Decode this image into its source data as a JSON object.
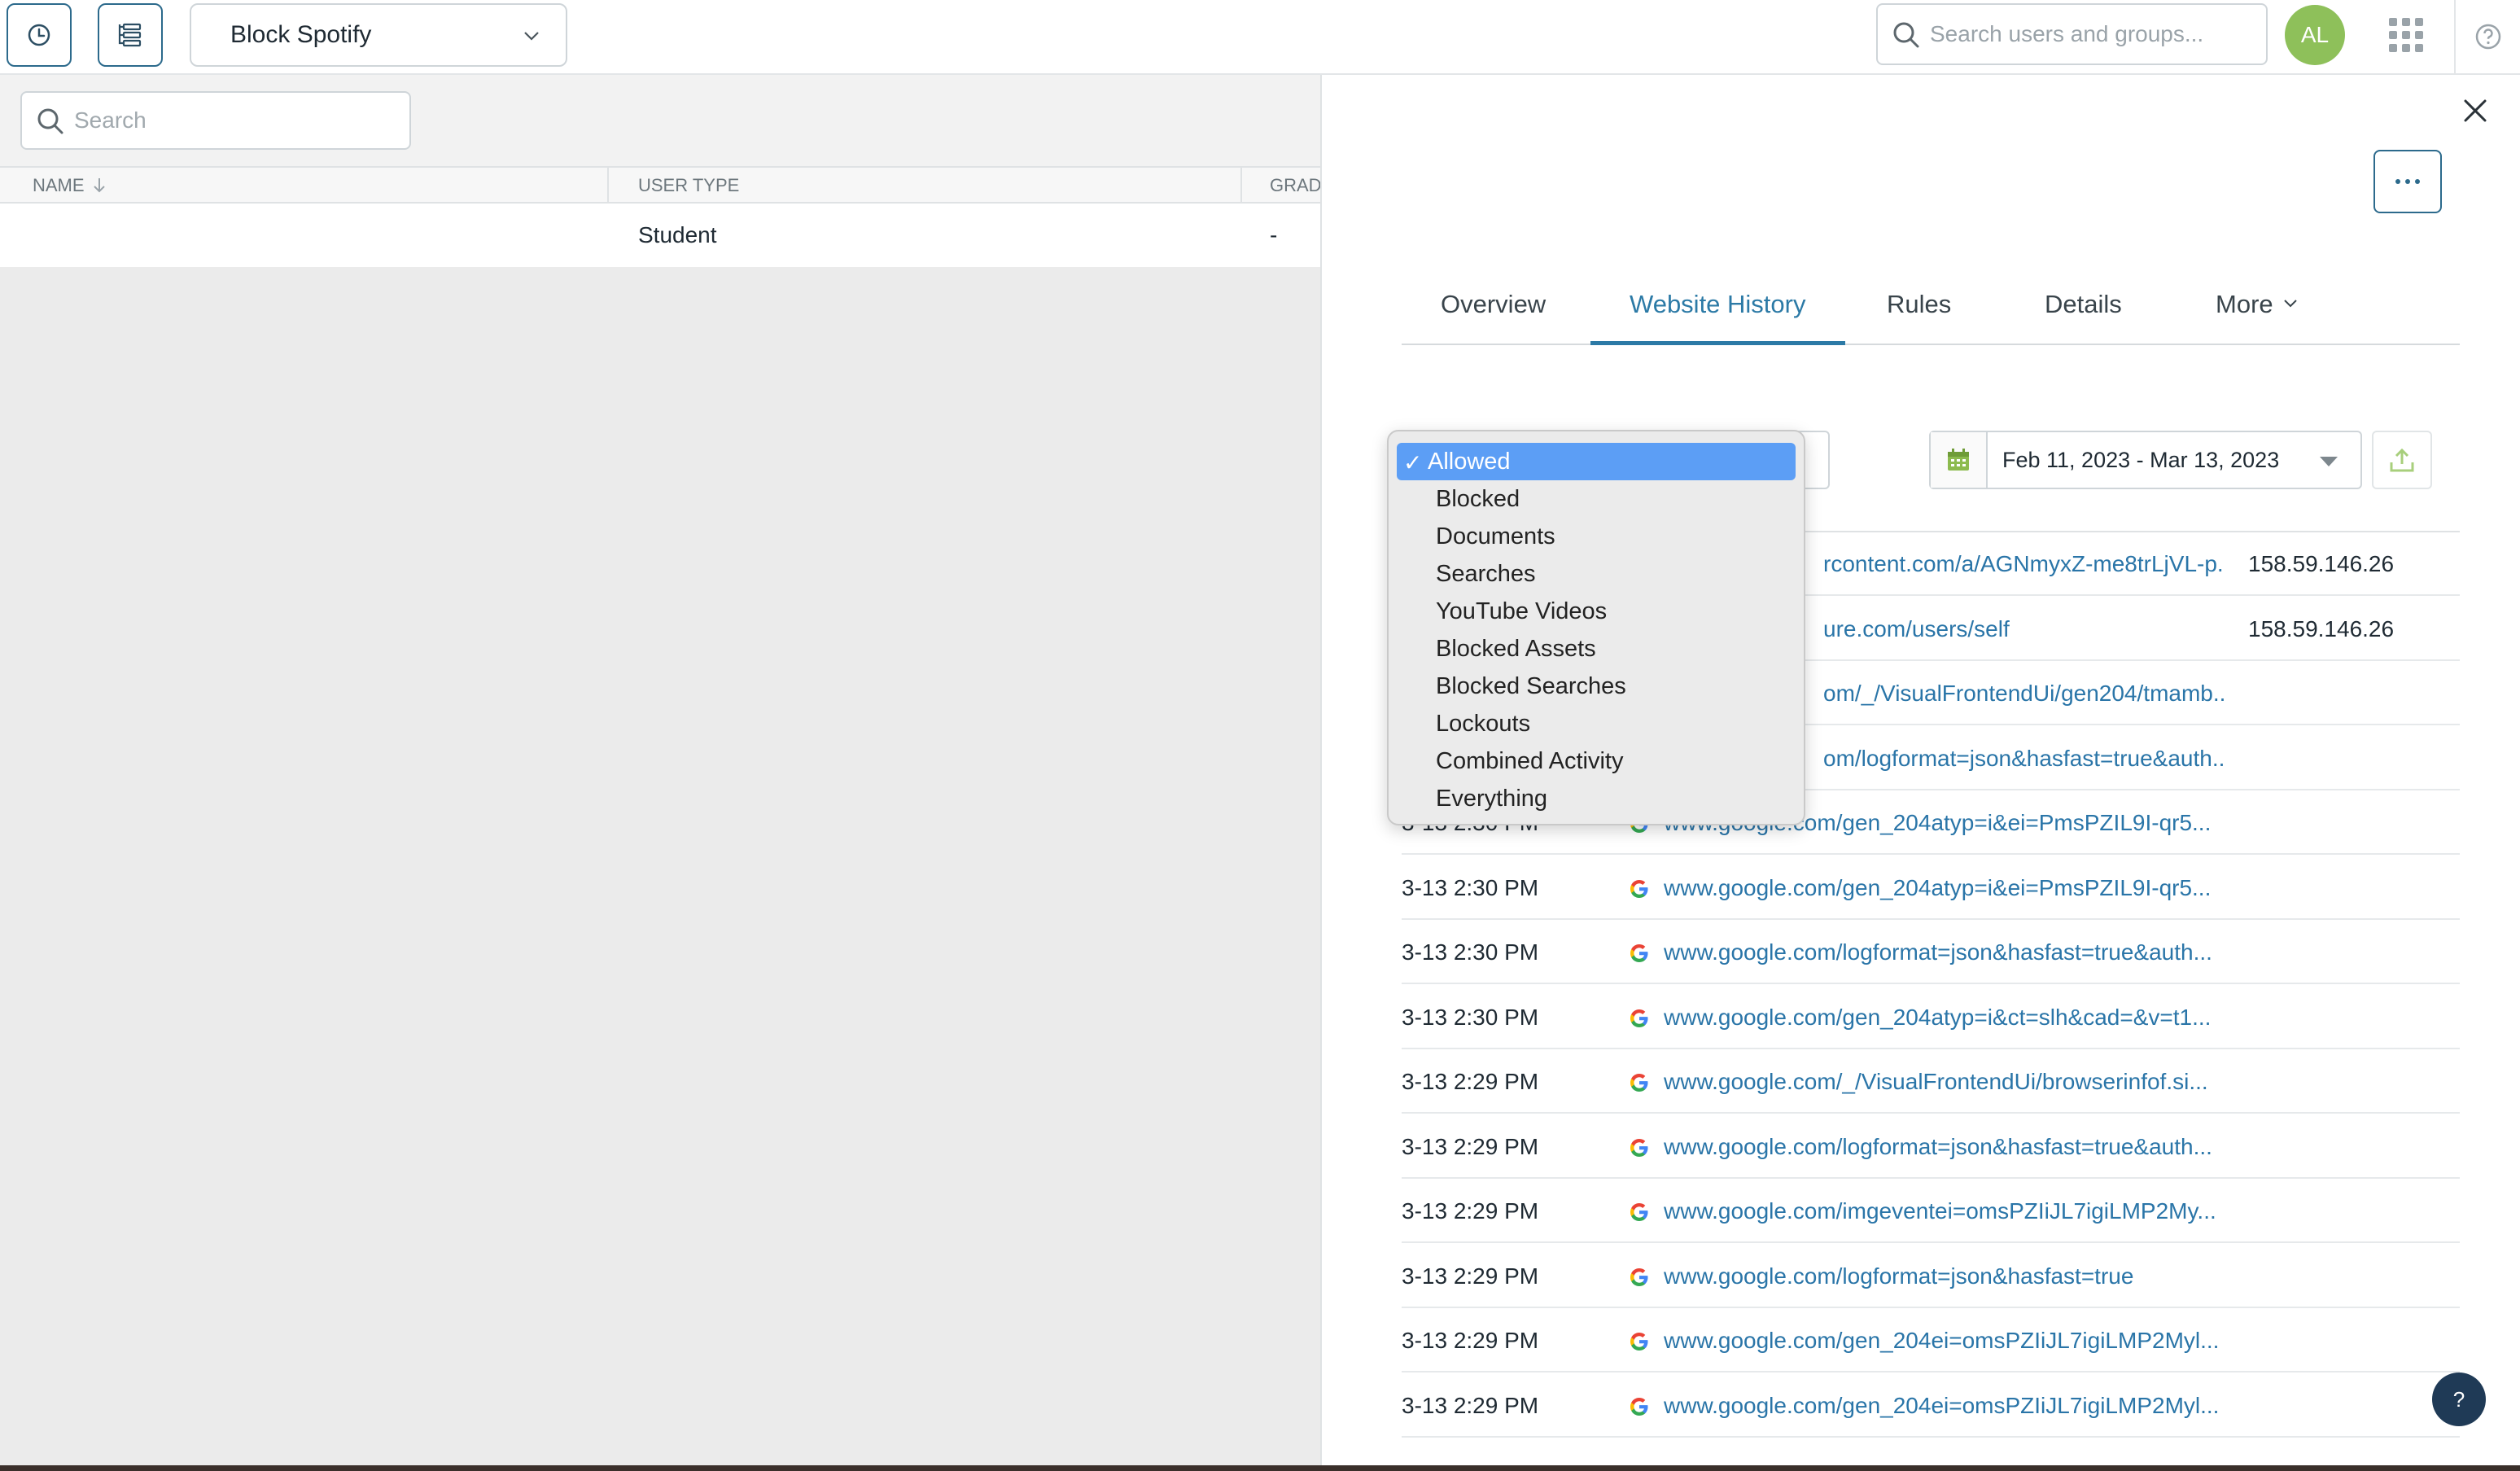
{
  "topbar": {
    "policy_select": "Block Spotify",
    "search_placeholder": "Search users and groups...",
    "avatar_initials": "AL"
  },
  "left": {
    "search_placeholder": "Search",
    "columns": [
      "NAME",
      "USER TYPE",
      "GRAD"
    ],
    "row": {
      "name": "",
      "user_type": "Student",
      "grade": "-"
    }
  },
  "right": {
    "tabs": [
      "Overview",
      "Website History",
      "Rules",
      "Details",
      "More"
    ],
    "active_tab": "Website History",
    "date_range": "Feb 11, 2023 - Mar 13, 2023",
    "history": [
      {
        "time": "",
        "url": "rcontent.com/a/AGNmyxZ-me8trLjVL-p...",
        "ip": "158.59.146.26"
      },
      {
        "time": "",
        "url": "ure.com/users/self",
        "ip": "158.59.146.26"
      },
      {
        "time": "",
        "url": "om/_/VisualFrontendUi/gen204/tmamb...",
        "ip": ""
      },
      {
        "time": "",
        "url": "om/logformat=json&hasfast=true&auth...",
        "ip": ""
      },
      {
        "time": "3-13 2:30 PM",
        "url": "www.google.com/gen_204atyp=i&ei=PmsPZIL9I-qr5...",
        "ip": ""
      },
      {
        "time": "3-13 2:30 PM",
        "url": "www.google.com/gen_204atyp=i&ei=PmsPZIL9I-qr5...",
        "ip": ""
      },
      {
        "time": "3-13 2:30 PM",
        "url": "www.google.com/logformat=json&hasfast=true&auth...",
        "ip": ""
      },
      {
        "time": "3-13 2:30 PM",
        "url": "www.google.com/gen_204atyp=i&ct=slh&cad=&v=t1...",
        "ip": ""
      },
      {
        "time": "3-13 2:29 PM",
        "url": "www.google.com/_/VisualFrontendUi/browserinfof.si...",
        "ip": ""
      },
      {
        "time": "3-13 2:29 PM",
        "url": "www.google.com/logformat=json&hasfast=true&auth...",
        "ip": ""
      },
      {
        "time": "3-13 2:29 PM",
        "url": "www.google.com/imgeventei=omsPZIiJL7igiLMP2My...",
        "ip": ""
      },
      {
        "time": "3-13 2:29 PM",
        "url": "www.google.com/logformat=json&hasfast=true",
        "ip": ""
      },
      {
        "time": "3-13 2:29 PM",
        "url": "www.google.com/gen_204ei=omsPZIiJL7igiLMP2Myl...",
        "ip": ""
      },
      {
        "time": "3-13 2:29 PM",
        "url": "www.google.com/gen_204ei=omsPZIiJL7igiLMP2Myl...",
        "ip": ""
      }
    ],
    "help_fab": "?"
  },
  "filter_menu": {
    "check": "✓",
    "selected": "Allowed",
    "options": [
      "Allowed",
      "Blocked",
      "Documents",
      "Searches",
      "YouTube Videos",
      "Blocked Assets",
      "Blocked Searches",
      "Lockouts",
      "Combined Activity",
      "Everything"
    ]
  },
  "colors": {
    "accent": "#2c7aa6",
    "link": "#2a75a8",
    "avatar": "#8ec05a",
    "menu_highlight": "#5c9ef5"
  }
}
